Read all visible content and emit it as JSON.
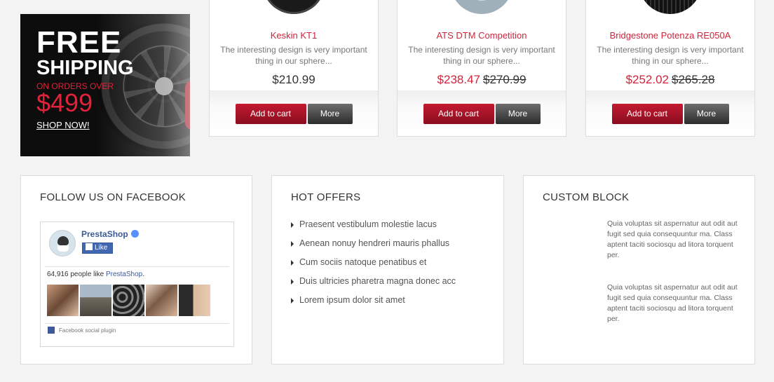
{
  "banner": {
    "line1": "FREE",
    "line2": "SHIPPING",
    "line3": "ON ORDERS OVER",
    "line4": "$499",
    "cta": "SHOP NOW!"
  },
  "products": [
    {
      "name": "Keskin KT1",
      "description": "The interesting design is very important thing in our sphere...",
      "price": "$210.99",
      "old_price": "",
      "on_sale": false,
      "add_to_cart": "Add to cart",
      "more": "More"
    },
    {
      "name": "ATS DTM Competition",
      "description": "The interesting design is very important thing in our sphere...",
      "price": "$238.47",
      "old_price": "$270.99",
      "on_sale": true,
      "add_to_cart": "Add to cart",
      "more": "More"
    },
    {
      "name": "Bridgestone Potenza RE050A",
      "description": "The interesting design is very important thing in our sphere...",
      "price": "$252.02",
      "old_price": "$265.28",
      "on_sale": true,
      "add_to_cart": "Add to cart",
      "more": "More"
    }
  ],
  "facebook_block": {
    "title": "FOLLOW US ON FACEBOOK",
    "page_name": "PrestaShop",
    "like_label": "Like",
    "count_prefix": "64,916 people like ",
    "count_link": "PrestaShop",
    "count_suffix": ".",
    "plugin_label": "Facebook social plugin"
  },
  "hot_offers": {
    "title": "HOT OFFERS",
    "items": [
      "Praesent vestibulum molestie lacus",
      "Aenean nonuy hendreri mauris phallus",
      "Cum sociis natoque penatibus et",
      "Duis ultricies pharetra magna donec acc",
      "Lorem ipsum dolor sit amet"
    ]
  },
  "custom_block": {
    "title": "CUSTOM BLOCK",
    "paragraphs": [
      "Quia voluptas sit aspernatur aut odit aut fugit sed quia consequuntur ma. Class aptent taciti sociosqu ad litora torquent per.",
      "Quia voluptas sit aspernatur aut odit aut fugit sed quia consequuntur ma. Class aptent taciti sociosqu ad litora torquent per."
    ]
  },
  "colors": {
    "accent": "#d0243b",
    "button_red": "#a4142a",
    "button_dark": "#3d3d3d",
    "facebook": "#3b5998"
  }
}
